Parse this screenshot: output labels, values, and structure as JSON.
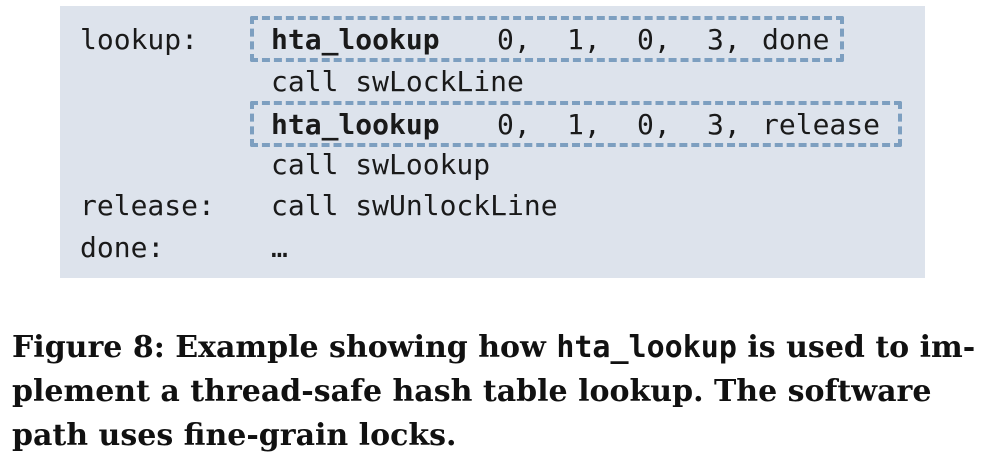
{
  "code": {
    "labels": {
      "lookup": "lookup:",
      "release": "release:",
      "done": "done:"
    },
    "line1": {
      "op": "hta_lookup",
      "a": "0,",
      "b": "1,",
      "c": "0,",
      "d": "3,",
      "target": "done"
    },
    "line2": "call swLockLine",
    "line3": {
      "op": "hta_lookup",
      "a": "0,",
      "b": "1,",
      "c": "0,",
      "d": "3,",
      "target": "release"
    },
    "line4": "call swLookup",
    "line5": "call swUnlockLine",
    "line6": "…"
  },
  "caption": {
    "prefix": "Figure 8: Example showing how ",
    "code": "hta_lookup",
    "suffix": " is used to im-plement a thread-safe hash table lookup. The software path uses fine-grain locks."
  },
  "colors": {
    "box_background": "#dde3ec",
    "dash_border": "#7d9fc0"
  }
}
